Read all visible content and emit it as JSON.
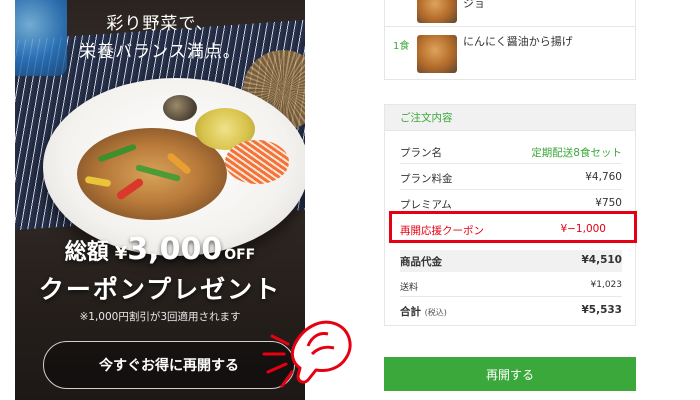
{
  "promo": {
    "headline_line1": "彩り野菜で、",
    "headline_line2": "栄養バランス満点。",
    "amount_prefix": "総額",
    "amount_currency": "¥",
    "amount_value": "3,000",
    "amount_suffix": "OFF",
    "coupon_text": "クーポンプレゼント",
    "note": "※1,000円割引が3回適用されます",
    "cta_label": "今すぐお得に再開する"
  },
  "items": [
    {
      "qty": "",
      "name": "ジョ"
    },
    {
      "qty": "1食",
      "name": "にんにく醤油から揚げ"
    }
  ],
  "order": {
    "header": "ご注文内容",
    "rows": [
      {
        "label": "プラン名",
        "value": "定期配送8食セット"
      },
      {
        "label": "プラン料金",
        "value": "¥4,760"
      },
      {
        "label": "プレミアム",
        "value": "¥750"
      }
    ],
    "coupon": {
      "label": "再開応援クーポン",
      "value": "¥−1,000"
    },
    "subtotal": {
      "label": "商品代金",
      "value": "¥4,510"
    },
    "shipping": {
      "label": "送料",
      "value": "¥1,023"
    },
    "total": {
      "label": "合計",
      "tax_note": "(税込)",
      "value": "¥5,533"
    }
  },
  "resume_button": "再開する",
  "colors": {
    "accent_green": "#3aa83a",
    "highlight_red": "#e60012"
  }
}
